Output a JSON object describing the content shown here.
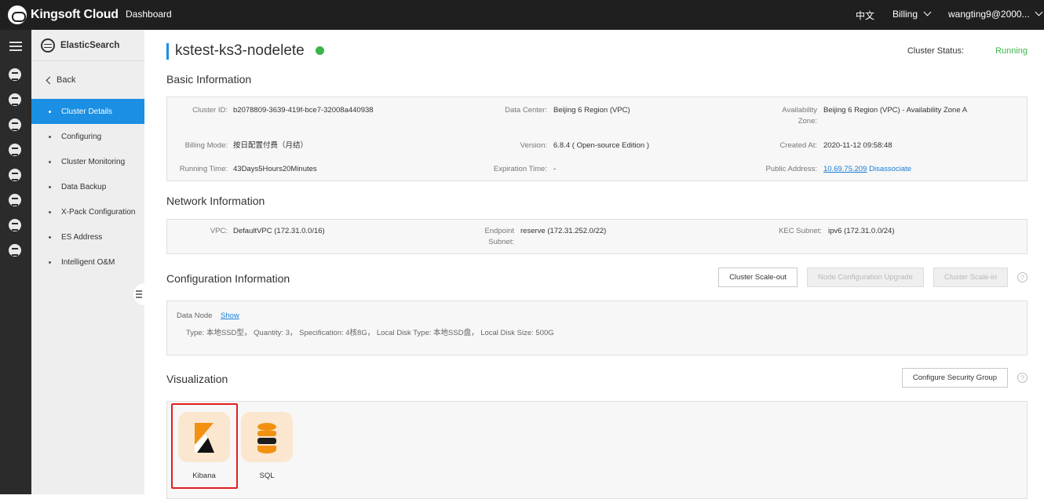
{
  "topbar": {
    "brand": "Kingsoft Cloud",
    "dashboard": "Dashboard",
    "language": "中文",
    "billing": "Billing",
    "user": "wangting9@2000..."
  },
  "rail": {
    "icons": [
      "menu-icon",
      "database-icon",
      "group-icon",
      "network-icon",
      "cloud-icon",
      "storage-icon",
      "stack-icon",
      "upload-icon",
      "id-card-icon"
    ]
  },
  "sidebar": {
    "title": "ElasticSearch",
    "back": "Back",
    "items": [
      {
        "label": "Cluster Details",
        "active": true
      },
      {
        "label": "Configuring"
      },
      {
        "label": "Cluster Monitoring"
      },
      {
        "label": "Data Backup"
      },
      {
        "label": "X-Pack Configuration"
      },
      {
        "label": "ES Address"
      },
      {
        "label": "Intelligent O&M"
      }
    ]
  },
  "header": {
    "title": "kstest-ks3-nodelete",
    "status_label": "Cluster Status:",
    "status_value": "Running",
    "status_color": "#3bb54a"
  },
  "basic": {
    "title": "Basic Information",
    "cluster_id_label": "Cluster ID:",
    "cluster_id": "b2078809-3639-419f-bce7-32008a440938",
    "data_center_label": "Data Center:",
    "data_center": "Beijing 6 Region (VPC)",
    "az_label_1": "Availability",
    "az_label_2": "Zone:",
    "az": "Beijing 6 Region (VPC) - Availability Zone A",
    "billing_label": "Billing Mode:",
    "billing": "按日配置付费（月结）",
    "version_label": "Version:",
    "version": "6.8.4 ( Open-source Edition )",
    "created_label": "Created At:",
    "created": "2020-11-12 09:58:48",
    "running_label": "Running Time:",
    "running": "43Days5Hours20Minutes",
    "expiration_label": "Expiration Time:",
    "expiration": "-",
    "public_label": "Public Address:",
    "public_ip": "10.69.75.209",
    "disassociate": "Disassociate"
  },
  "network": {
    "title": "Network Information",
    "vpc_label": "VPC:",
    "vpc": "DefaultVPC (172.31.0.0/16)",
    "endpoint_label_1": "Endpoint",
    "endpoint_label_2": "Subnet:",
    "endpoint": "reserve (172.31.252.0/22)",
    "kec_label": "KEC Subnet:",
    "kec": "ipv6 (172.31.0.0/24)"
  },
  "config": {
    "title": "Configuration Information",
    "scale_out": "Cluster Scale-out",
    "upgrade": "Node Configuration Upgrade",
    "scale_in": "Cluster Scale-in",
    "data_node_label": "Data Node",
    "show": "Show",
    "detail": "Type: 本地SSD型， Quantity: 3， Specification: 4核8G， Local Disk Type: 本地SSD盘， Local Disk Size: 500G"
  },
  "viz": {
    "title": "Visualization",
    "security_group": "Configure Security Group",
    "tiles": [
      {
        "label": "Kibana",
        "icon": "kibana-icon"
      },
      {
        "label": "SQL",
        "icon": "sql-database-icon"
      }
    ],
    "highlight_color": "#e02020"
  }
}
